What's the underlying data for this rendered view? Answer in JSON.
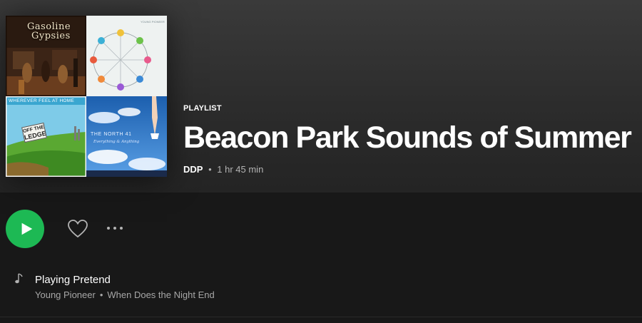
{
  "playlist": {
    "type_label": "PLAYLIST",
    "title": "Beacon Park Sounds of Summer",
    "owner": "DDP",
    "separator": "•",
    "duration": "1 hr 45 min"
  },
  "cover": {
    "tile1": {
      "line1": "Gasoline",
      "line2": "Gypsies"
    },
    "tile2": {
      "caption": "YOUNG PIONEER"
    },
    "tile3": {
      "banner": "WHEREVER FEEL AT HOME",
      "sign_line1": "OFF THE",
      "sign_line2": "LEDGE"
    },
    "tile4": {
      "line1": "THE NORTH 41",
      "line2": "Everything & Anything"
    }
  },
  "actions": {
    "play_icon": "play-icon",
    "like_icon": "heart-icon",
    "more_icon": "more-horizontal-icon"
  },
  "now_playing": {
    "icon": "music-note-icon",
    "track": "Playing Pretend",
    "artist": "Young Pioneer",
    "separator": "•",
    "album": "When Does the Night End"
  },
  "colors": {
    "accent": "#1db954",
    "background": "#181818",
    "header_top": "#3a3a3a",
    "muted_text": "#b3b3b3"
  }
}
